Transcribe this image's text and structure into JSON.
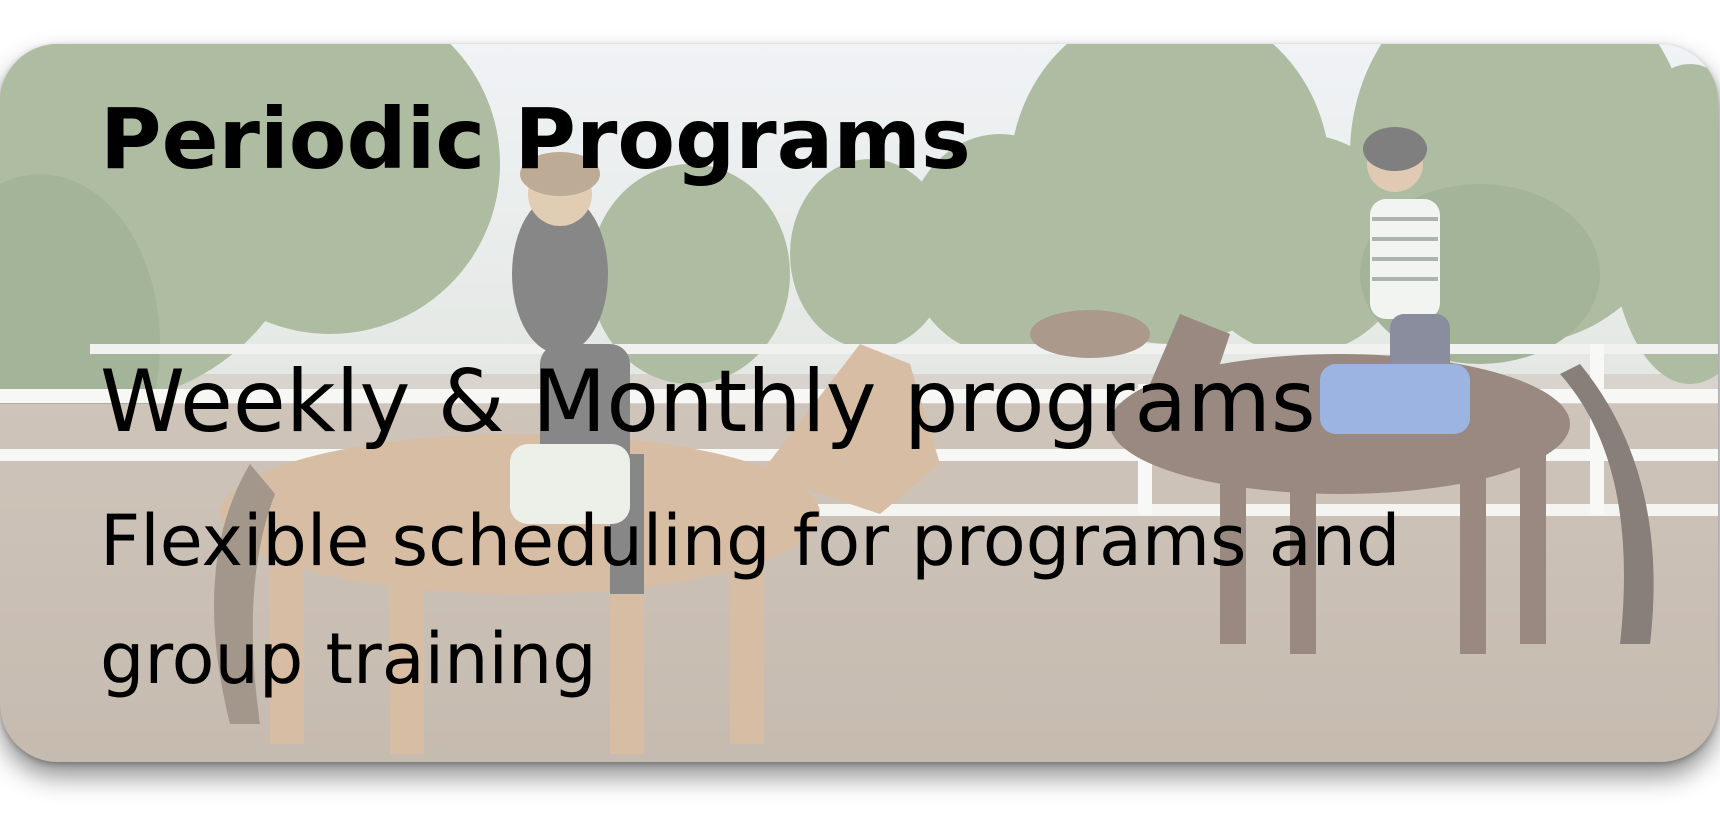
{
  "card": {
    "title": "Periodic Programs",
    "headline": "Weekly & Monthly programs",
    "subtext": "Flexible scheduling for programs and group training",
    "background_image": "horse-riding-arena-photo",
    "overlay_color": "#ffffff"
  }
}
